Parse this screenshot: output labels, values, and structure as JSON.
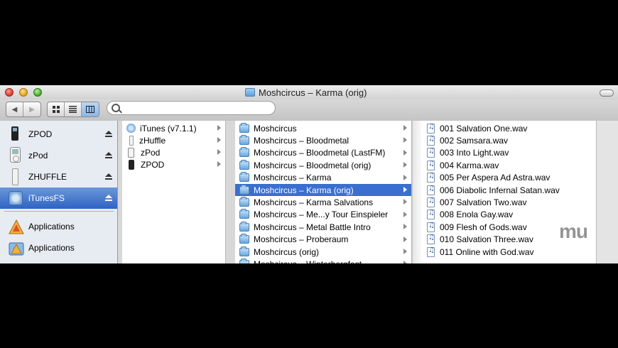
{
  "window": {
    "title": "Moshcircus – Karma (orig)"
  },
  "toolbar": {
    "back_label": "◀",
    "forward_label": "▶",
    "view_icons": "icon-view-icon",
    "view_list": "list-view-icon",
    "view_columns": "column-view-icon",
    "search_placeholder": ""
  },
  "sidebar": {
    "devices": [
      {
        "label": "ZPOD",
        "icon": "ipod-black-icon",
        "ejectable": true
      },
      {
        "label": "zPod",
        "icon": "ipod-white-icon",
        "ejectable": true
      },
      {
        "label": "ZHUFFLE",
        "icon": "ipod-shuffle-icon",
        "ejectable": true
      },
      {
        "label": "iTunesFS",
        "icon": "itunesfs-drive-icon",
        "ejectable": true,
        "selected": true
      }
    ],
    "places": [
      {
        "label": "Applications",
        "icon": "applications-folder-icon"
      },
      {
        "label": "Applications",
        "icon": "applications-folder-icon"
      }
    ]
  },
  "column1": {
    "items": [
      {
        "label": "iTunes (v7.1.1)",
        "icon": "itunes-icon",
        "has_children": true
      },
      {
        "label": "zHuffle",
        "icon": "ipod-shuffle-icon",
        "has_children": true
      },
      {
        "label": "zPod",
        "icon": "ipod-white-icon",
        "has_children": true
      },
      {
        "label": "ZPOD",
        "icon": "ipod-black-icon",
        "has_children": true
      }
    ]
  },
  "column2": {
    "items": [
      {
        "label": "Moshcircus"
      },
      {
        "label": "Moshcircus – Bloodmetal"
      },
      {
        "label": "Moshcircus – Bloodmetal (LastFM)"
      },
      {
        "label": "Moshcircus – Bloodmetal (orig)"
      },
      {
        "label": "Moshcircus – Karma"
      },
      {
        "label": "Moshcircus – Karma (orig)",
        "selected": true
      },
      {
        "label": "Moshcircus – Karma Salvations"
      },
      {
        "label": "Moshcircus – Me...y Tour Einspieler"
      },
      {
        "label": "Moshcircus – Metal Battle Intro"
      },
      {
        "label": "Moshcircus – Proberaum"
      },
      {
        "label": "Moshcircus (orig)"
      },
      {
        "label": "Moshcircus – Winterbergfest"
      }
    ]
  },
  "column3": {
    "items": [
      {
        "label": "001 Salvation One.wav"
      },
      {
        "label": "002 Samsara.wav"
      },
      {
        "label": "003 Into Light.wav"
      },
      {
        "label": "004 Karma.wav"
      },
      {
        "label": "005 Per Aspera Ad Astra.wav"
      },
      {
        "label": "006 Diabolic Infernal Satan.wav"
      },
      {
        "label": "007 Salvation Two.wav"
      },
      {
        "label": "008 Enola Gay.wav"
      },
      {
        "label": "009 Flesh of Gods.wav"
      },
      {
        "label": "010 Salvation Three.wav"
      },
      {
        "label": "011 Online with God.wav"
      }
    ]
  },
  "watermark": "mu"
}
